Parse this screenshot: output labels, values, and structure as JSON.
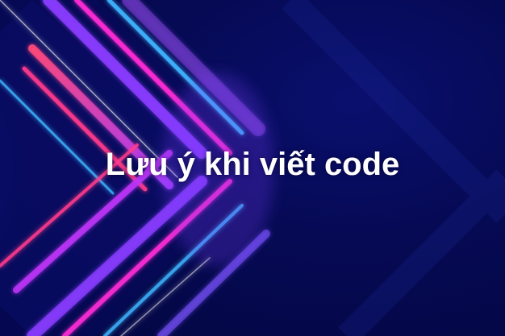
{
  "banner": {
    "title": "Lưu ý khi viết code"
  },
  "colors": {
    "background": "#04074a",
    "magenta": "#ff2bd6",
    "pink": "#ff3a8c",
    "violet": "#8a3cff",
    "blue": "#2a6bff",
    "cyan": "#3fb6ff",
    "title_text": "#ffffff"
  }
}
